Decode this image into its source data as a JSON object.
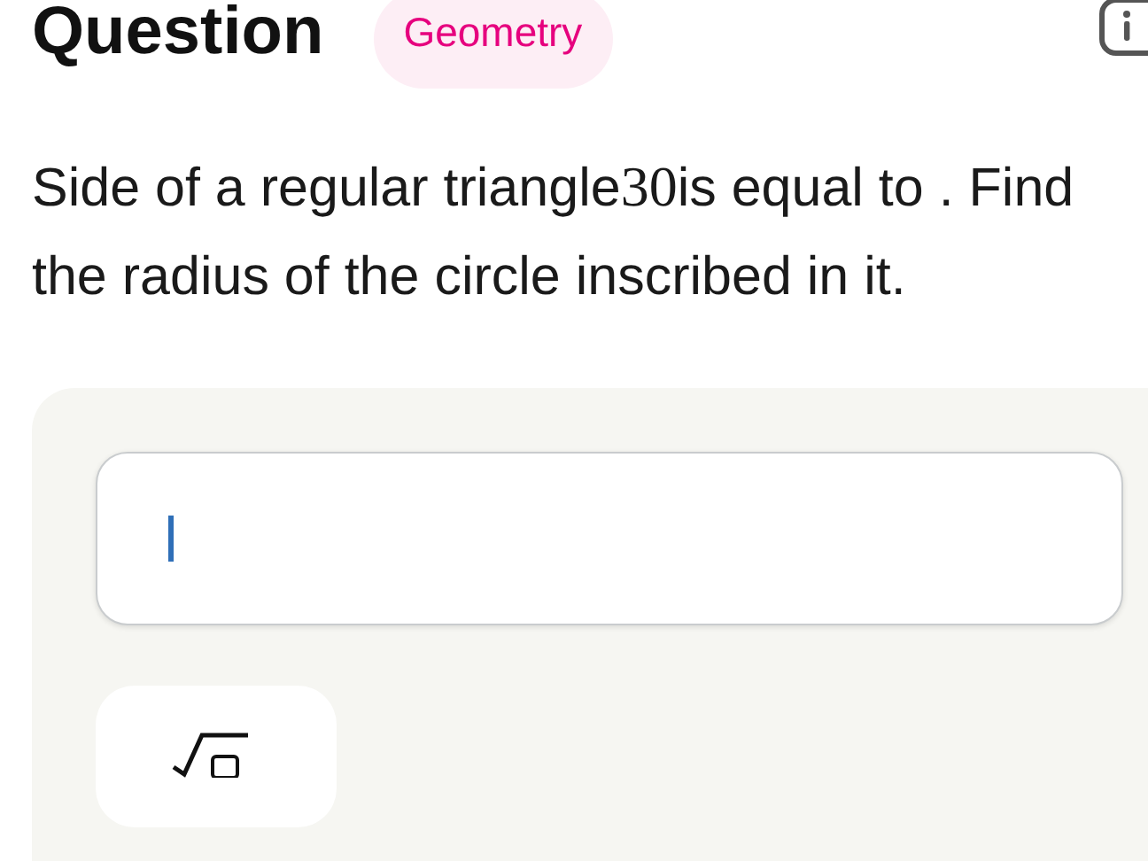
{
  "header": {
    "title": "Question",
    "tag": "Geometry"
  },
  "question": {
    "text_before": "Side of a regular triangle",
    "math": "30",
    "text_after": "is equal to . Find the radius of the circle inscribed in it."
  },
  "answer": {
    "focused": true
  }
}
